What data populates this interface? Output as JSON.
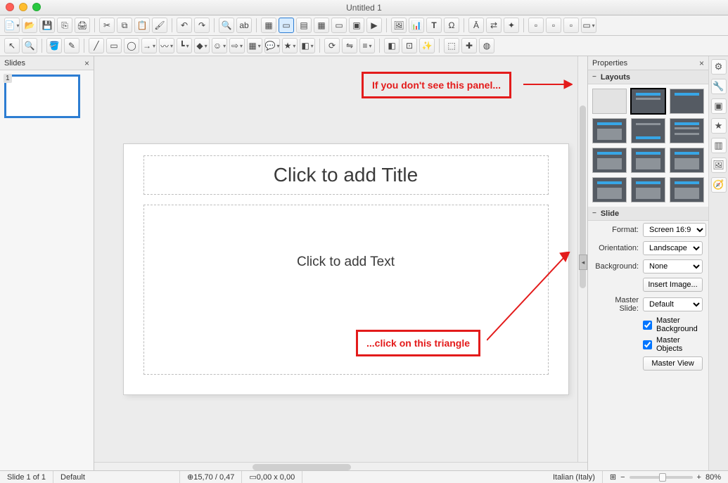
{
  "window": {
    "title": "Untitled 1"
  },
  "panels": {
    "slides_label": "Slides",
    "properties_label": "Properties",
    "layouts_label": "Layouts",
    "slide_section_label": "Slide"
  },
  "thumb": {
    "number": "1"
  },
  "placeholders": {
    "title": "Click to add Title",
    "text": "Click to add Text"
  },
  "callouts": {
    "top": "If you don't see this panel...",
    "bottom": "...click on this triangle"
  },
  "slideform": {
    "format_label": "Format:",
    "format_value": "Screen 16:9",
    "orientation_label": "Orientation:",
    "orientation_value": "Landscape",
    "background_label": "Background:",
    "background_value": "None",
    "insert_image": "Insert Image...",
    "master_slide_label": "Master Slide:",
    "master_slide_value": "Default",
    "master_bg_label": "Master Background",
    "master_obj_label": "Master Objects",
    "master_view": "Master View"
  },
  "status": {
    "slidecount": "Slide 1 of 1",
    "style": "Default",
    "pos": "15,70 / 0,47",
    "size": "0,00 x 0,00",
    "lang": "Italian (Italy)",
    "zoom": "80%"
  }
}
